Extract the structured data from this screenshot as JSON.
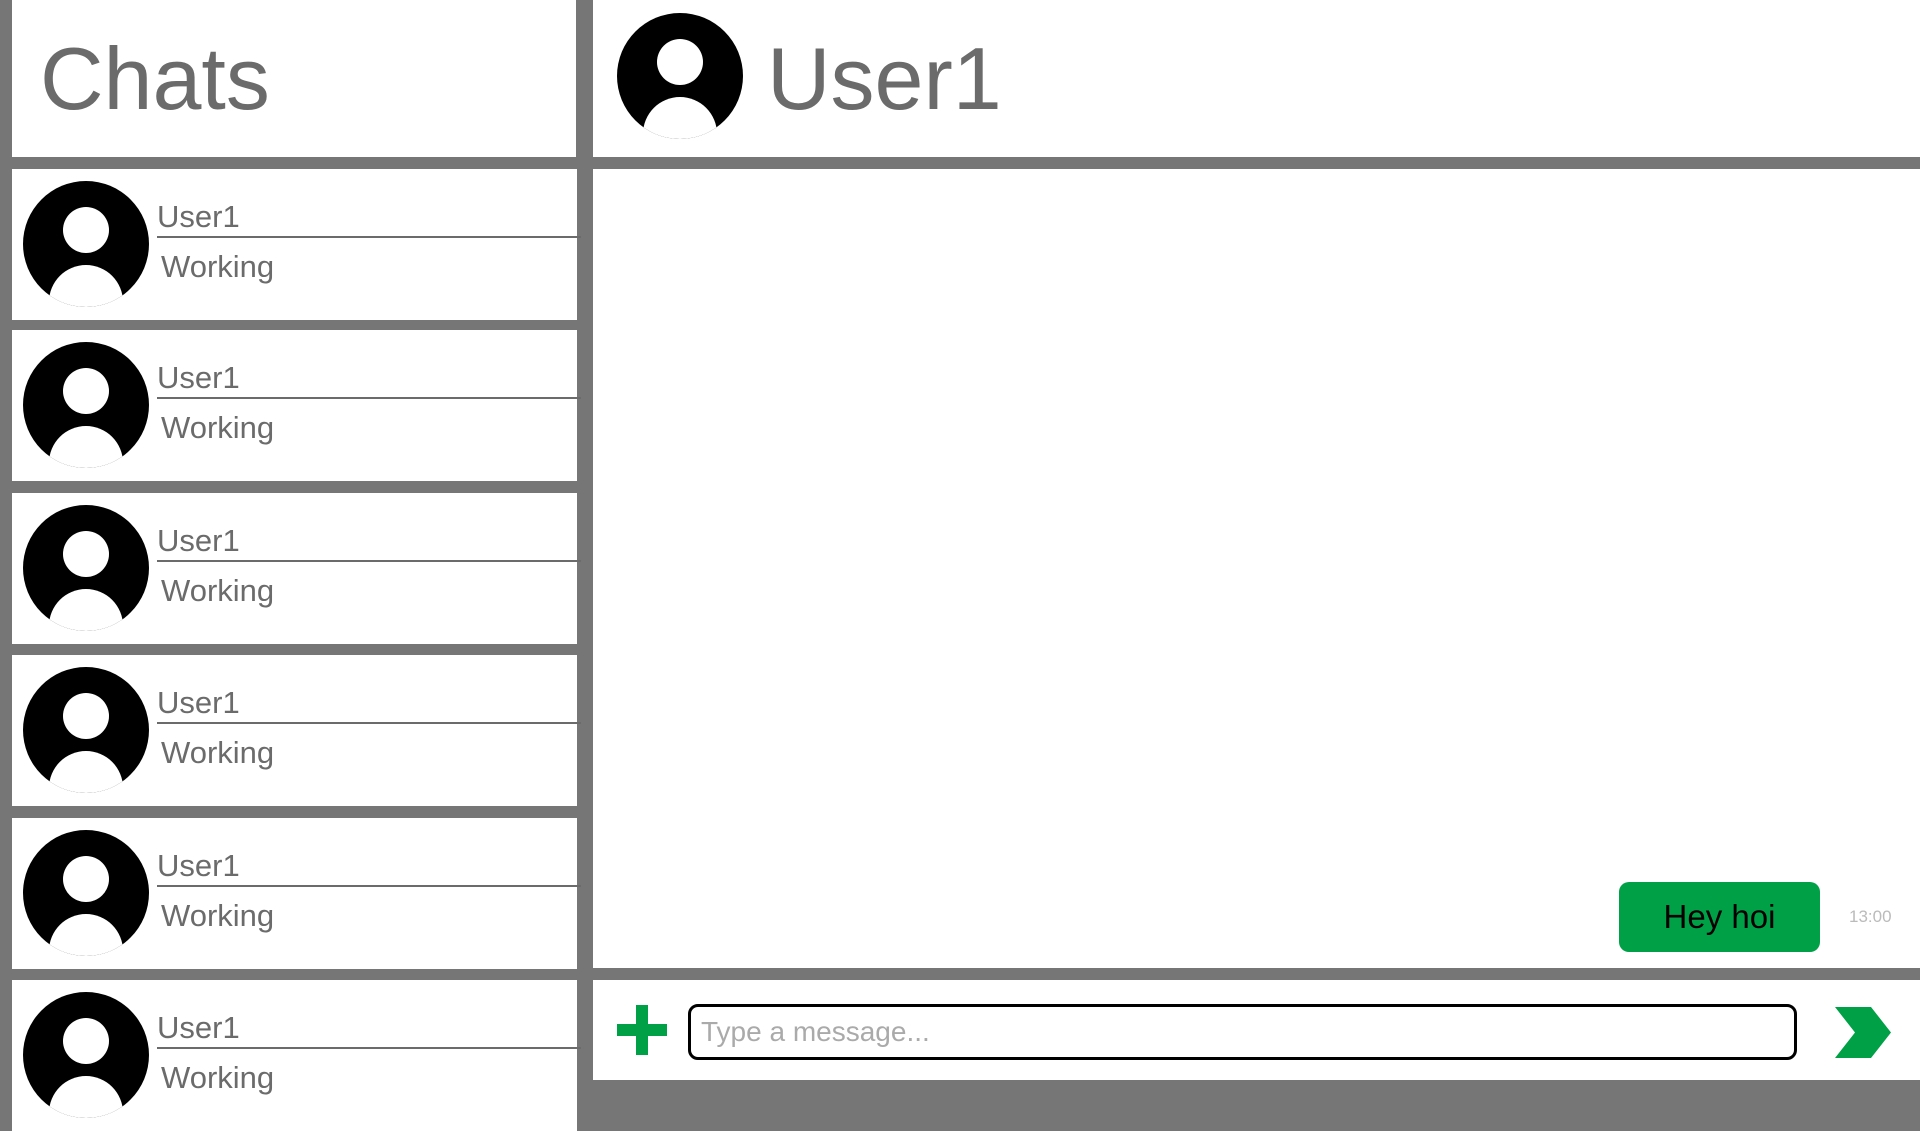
{
  "sidebar": {
    "title": "Chats",
    "items": [
      {
        "name": "User1",
        "status": "Working"
      },
      {
        "name": "User1",
        "status": "Working"
      },
      {
        "name": "User1",
        "status": "Working"
      },
      {
        "name": "User1",
        "status": "Working"
      },
      {
        "name": "User1",
        "status": "Working"
      },
      {
        "name": "User1",
        "status": "Working"
      }
    ]
  },
  "conversation": {
    "name": "User1",
    "messages": [
      {
        "text": "Hey hoi",
        "time": "13:00",
        "direction": "outgoing"
      }
    ]
  },
  "composer": {
    "placeholder": "Type a message...",
    "value": "",
    "attach_icon": "plus-icon",
    "send_icon": "chevron-right-icon"
  },
  "colors": {
    "accent": "#00A046",
    "frame": "#767676",
    "text": "#6B6B6B"
  }
}
